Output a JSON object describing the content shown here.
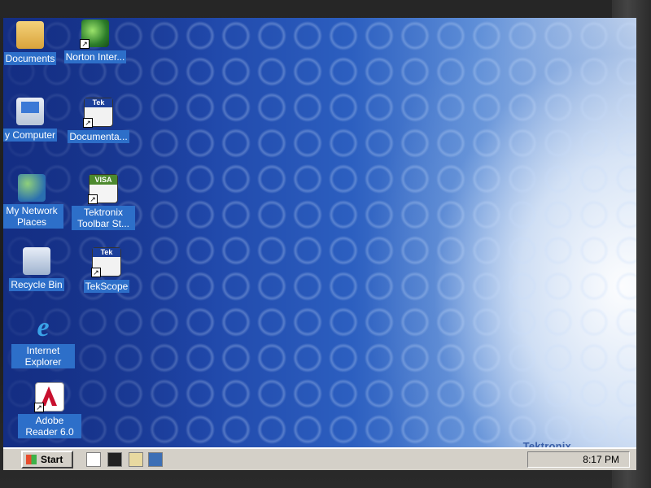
{
  "desktop": {
    "icons": [
      {
        "label": "Documents",
        "icon": "folder-icon"
      },
      {
        "label": "Norton Inter...",
        "icon": "globe-icon"
      },
      {
        "label": "y Computer",
        "icon": "computer-icon"
      },
      {
        "label": "Documenta...",
        "icon": "tek-document-icon"
      },
      {
        "label": "My Network Places",
        "icon": "network-icon"
      },
      {
        "label": "Tektronix Toolbar St...",
        "icon": "visa-icon"
      },
      {
        "label": "Recycle Bin",
        "icon": "recycle-bin-icon"
      },
      {
        "label": "TekScope",
        "icon": "tek-scope-icon"
      },
      {
        "label": "Internet Explorer",
        "icon": "internet-explorer-icon"
      },
      {
        "label": "Adobe Reader 6.0",
        "icon": "adobe-reader-icon"
      }
    ],
    "brand": "Tektronix",
    "icon_glyphs": {
      "ie": "e"
    }
  },
  "taskbar": {
    "start_label": "Start",
    "clock": "8:17 PM"
  },
  "colors": {
    "desktop_blue": "#1f46a8",
    "label_highlight": "#2d6fc9",
    "taskbar": "#d4d0c8",
    "brand": "#3a5fa8"
  }
}
